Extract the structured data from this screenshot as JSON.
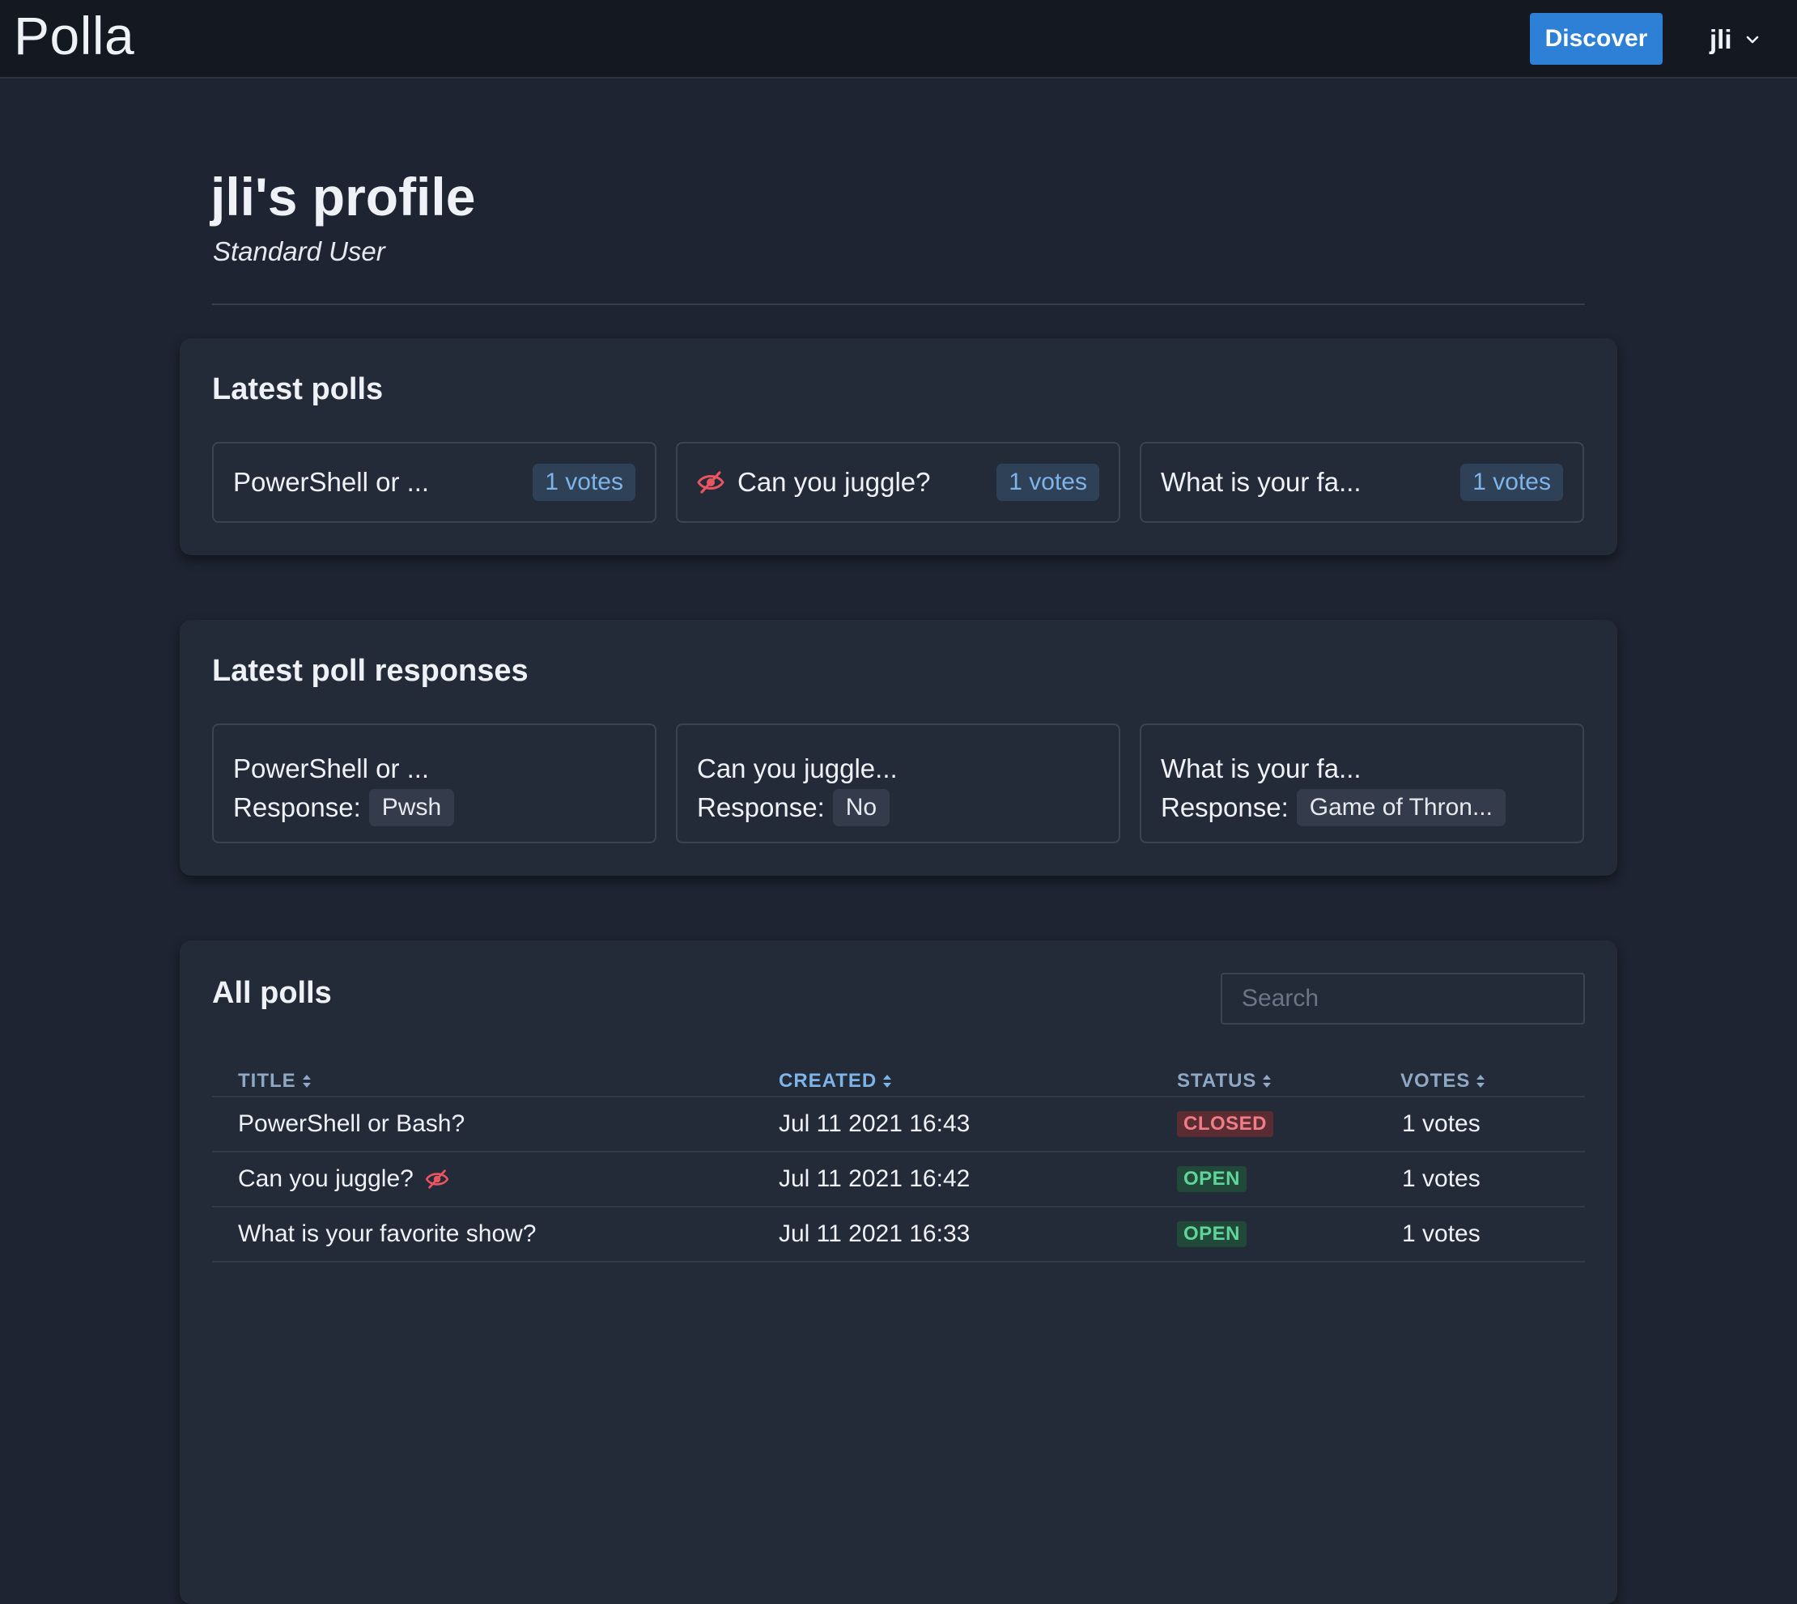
{
  "app": {
    "brand": "Polla",
    "discover_label": "Discover",
    "user_name": "jli"
  },
  "profile": {
    "title": "jli's profile",
    "role": "Standard User"
  },
  "latest_polls": {
    "title": "Latest polls",
    "items": [
      {
        "title": "PowerShell or ...",
        "votes": "1 votes",
        "hidden": false
      },
      {
        "title": "Can you juggle?",
        "votes": "1 votes",
        "hidden": true
      },
      {
        "title": "What is your fa...",
        "votes": "1 votes",
        "hidden": false
      }
    ]
  },
  "latest_responses": {
    "title": "Latest poll responses",
    "response_label": "Response:",
    "items": [
      {
        "title": "PowerShell or ...",
        "response": "Pwsh"
      },
      {
        "title": "Can you juggle...",
        "response": "No"
      },
      {
        "title": "What is your fa...",
        "response": "Game of Thron..."
      }
    ]
  },
  "all_polls": {
    "title": "All polls",
    "search_placeholder": "Search",
    "columns": [
      "TITLE",
      "CREATED",
      "STATUS",
      "VOTES"
    ],
    "active_sort_column": "CREATED",
    "rows": [
      {
        "title": "PowerShell or Bash?",
        "hidden": false,
        "created": "Jul 11 2021 16:43",
        "status": "CLOSED",
        "votes": "1 votes"
      },
      {
        "title": "Can you juggle?",
        "hidden": true,
        "created": "Jul 11 2021 16:42",
        "status": "OPEN",
        "votes": "1 votes"
      },
      {
        "title": "What is your favorite show?",
        "hidden": false,
        "created": "Jul 11 2021 16:33",
        "status": "OPEN",
        "votes": "1 votes"
      }
    ]
  },
  "colors": {
    "background": "#1e2431",
    "navbar": "#131821",
    "card": "#232a38",
    "accent": "#2d80d6",
    "hidden_icon": "#e8545f",
    "status_closed": "#f17b86",
    "status_open": "#5fd59a"
  },
  "icons": {
    "hidden": "eye-slash-icon",
    "sort": "sort-icon",
    "user_menu": "chevron-down-icon"
  }
}
